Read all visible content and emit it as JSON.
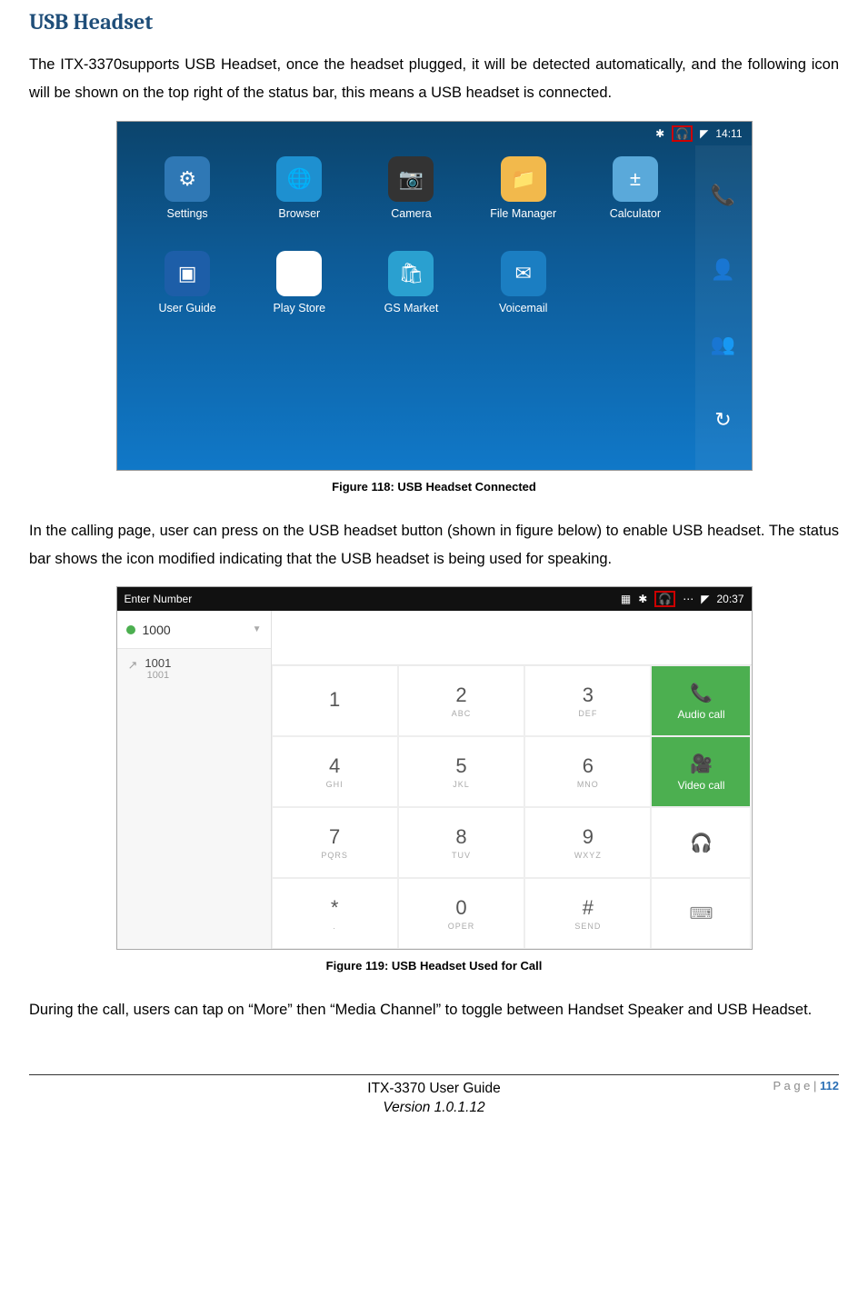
{
  "heading": "USB Headset",
  "para1": "The ITX-3370supports USB Headset, once the headset plugged, it will be detected automatically, and the following icon will be shown on the top right of the status bar, this means a USB headset is connected.",
  "fig1_caption": "Figure 118: USB Headset Connected",
  "para2": "In the calling page, user can press on the USB headset button (shown in figure below) to enable USB headset. The status bar shows the icon modified indicating that the USB headset is being used for speaking.",
  "fig2_caption": "Figure 119: USB Headset Used for Call",
  "para3": "During the call, users can tap on “More” then “Media Channel” to toggle between Handset Speaker and USB Headset.",
  "shot1": {
    "status_time": "14:11",
    "apps": [
      "Settings",
      "Browser",
      "Camera",
      "File Manager",
      "Calculator",
      "User Guide",
      "Play Store",
      "GS Market",
      "Voicemail"
    ]
  },
  "shot2": {
    "title": "Enter Number",
    "status_time": "20:37",
    "account": "1000",
    "history_num": "1001",
    "history_sub": "1001",
    "keys": [
      {
        "d": "1",
        "s": ""
      },
      {
        "d": "2",
        "s": "ABC"
      },
      {
        "d": "3",
        "s": "DEF"
      },
      {
        "d": "4",
        "s": "GHI"
      },
      {
        "d": "5",
        "s": "JKL"
      },
      {
        "d": "6",
        "s": "MNO"
      },
      {
        "d": "7",
        "s": "PQRS"
      },
      {
        "d": "8",
        "s": "TUV"
      },
      {
        "d": "9",
        "s": "WXYZ"
      },
      {
        "d": "*",
        "s": "."
      },
      {
        "d": "0",
        "s": "OPER"
      },
      {
        "d": "#",
        "s": "SEND"
      }
    ],
    "audio_label": "Audio call",
    "video_label": "Video call"
  },
  "footer": {
    "page_label": "P a g e | ",
    "page_num": "112",
    "line1": "ITX-3370 User Guide",
    "line2": "Version 1.0.1.12"
  }
}
